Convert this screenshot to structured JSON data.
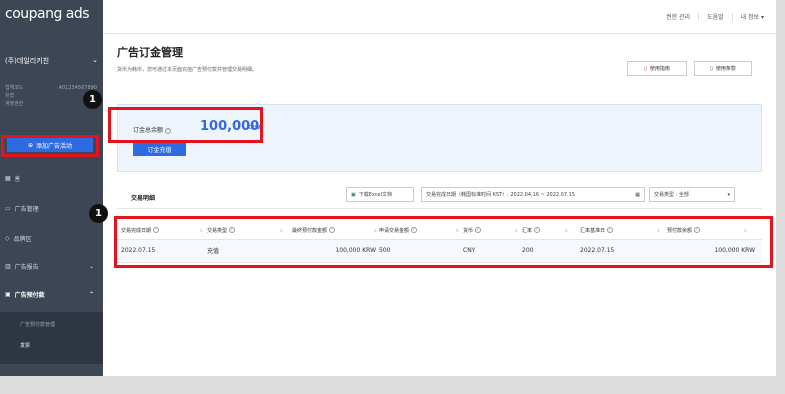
{
  "sidebar": {
    "logo": "coupang ads",
    "account_name": "(주)데일리키친",
    "meta": [
      {
        "label": "업체코드",
        "value": "A01234567890"
      },
      {
        "label": "유형",
        "value": ""
      },
      {
        "label": "계정권한",
        "value": ""
      }
    ],
    "add_campaign": "添加广告活动",
    "items": [
      {
        "label": "홈",
        "icon": "grid-icon"
      },
      {
        "label": "广告管理",
        "icon": "folder-icon"
      },
      {
        "label": "品牌区",
        "icon": "gem-icon"
      },
      {
        "label": "广告报告",
        "icon": "bar-chart-icon"
      },
      {
        "label": "广告预付款",
        "icon": "wallet-icon"
      }
    ],
    "sub_items": [
      "广告预付款管理",
      "发票"
    ]
  },
  "topbar": {
    "links": [
      "권한 관리",
      "도움말",
      "내 정보 ▾"
    ]
  },
  "header": {
    "title": "广告订金管理",
    "subtitle": "货币为韩币，您可通过本页面充值广告预付款并管理交易明细。",
    "guide_btn": "使用指南",
    "terms_btn": "使用条款"
  },
  "balance": {
    "label": "订金总余额",
    "value": "100,000",
    "unit": "KRW",
    "charge_btn": "订金充值"
  },
  "transactions": {
    "title": "交易明细",
    "download": "下载Excel文档",
    "date_range": "交易完成日期（韩国标准时间 KST）: 2022.04.16 ~ 2022.07.15",
    "type_filter": "交易类型 : 全部",
    "columns": [
      "交易完成日期",
      "交易类型",
      "最终预付款金额",
      "申请交易金额",
      "货币",
      "汇率",
      "汇率基准日",
      "预付款余额"
    ],
    "rows": [
      [
        "2022.07.15",
        "充值",
        "100,000 KRW",
        "500",
        "CNY",
        "200",
        "2022.07.15",
        "100,000 KRW"
      ]
    ]
  },
  "annotations": [
    "1",
    "1"
  ],
  "colors": {
    "accent": "#2f6be0",
    "highlight": "#e4141e",
    "sidebar": "#3d4654"
  }
}
